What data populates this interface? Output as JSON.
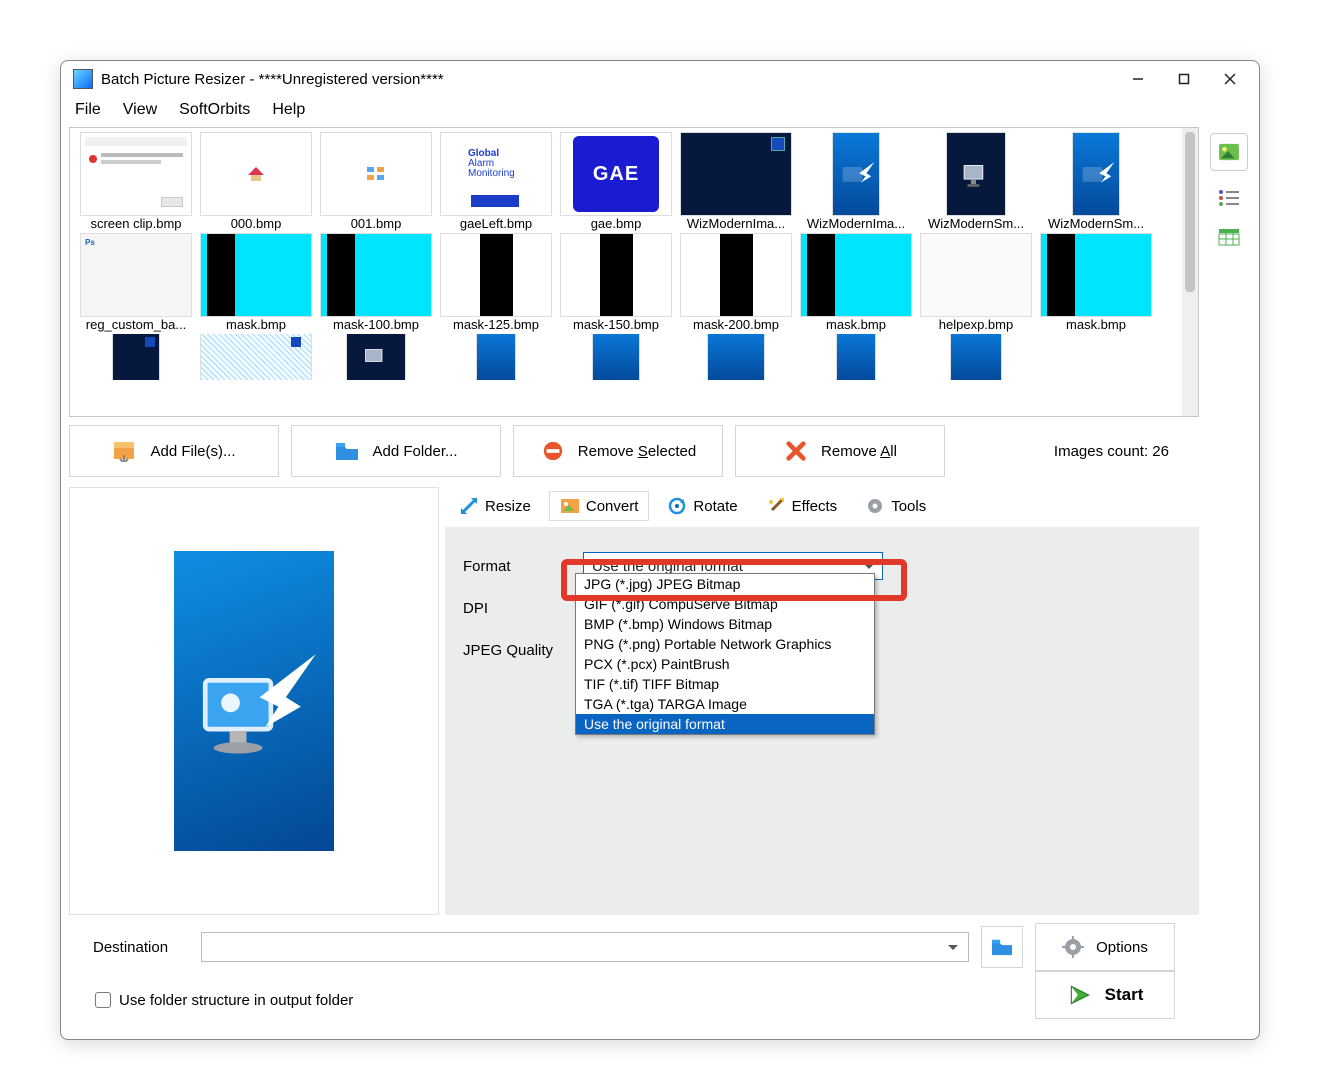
{
  "window": {
    "title": "Batch Picture Resizer - ****Unregistered version****"
  },
  "menu": {
    "file": "File",
    "view": "View",
    "softorbits": "SoftOrbits",
    "help": "Help"
  },
  "thumbs": [
    {
      "cap": "screen clip.bmp"
    },
    {
      "cap": "000.bmp"
    },
    {
      "cap": "001.bmp"
    },
    {
      "cap": "gaeLeft.bmp"
    },
    {
      "cap": "gae.bmp"
    },
    {
      "cap": "WizModernIma..."
    },
    {
      "cap": "WizModernIma..."
    },
    {
      "cap": "WizModernSm..."
    },
    {
      "cap": "WizModernSm..."
    },
    {
      "cap": "reg_custom_ba..."
    },
    {
      "cap": "mask.bmp"
    },
    {
      "cap": "mask-100.bmp"
    },
    {
      "cap": "mask-125.bmp"
    },
    {
      "cap": "mask-150.bmp"
    },
    {
      "cap": "mask-200.bmp"
    },
    {
      "cap": "mask.bmp"
    },
    {
      "cap": "helpexp.bmp"
    },
    {
      "cap": "mask.bmp"
    }
  ],
  "actions": {
    "add_files": "Add File(s)...",
    "add_folder": "Add Folder...",
    "remove_selected_pre": "Remove ",
    "remove_selected_u": "S",
    "remove_selected_post": "elected",
    "remove_all_pre": "Remove ",
    "remove_all_u": "A",
    "remove_all_post": "ll",
    "count": "Images count: 26"
  },
  "tabs": {
    "resize": "Resize",
    "convert": "Convert",
    "rotate": "Rotate",
    "effects": "Effects",
    "tools": "Tools"
  },
  "convert": {
    "format_label": "Format",
    "dpi_label": "DPI",
    "quality_label": "JPEG Quality",
    "selected": "Use the original format",
    "options": [
      "JPG (*.jpg) JPEG Bitmap",
      "GIF (*.gif) CompuServe Bitmap",
      "BMP (*.bmp) Windows Bitmap",
      "PNG (*.png) Portable Network Graphics",
      "PCX (*.pcx) PaintBrush",
      "TIF (*.tif) TIFF Bitmap",
      "TGA (*.tga) TARGA Image",
      "Use the original format"
    ]
  },
  "bottom": {
    "destination": "Destination",
    "options": "Options",
    "use_folder": "Use folder structure in output folder",
    "start": "Start"
  },
  "gae_left": {
    "l1": "Global",
    "l2": "Alarm",
    "l3": "Monitoring"
  },
  "gae_box": "GAE"
}
